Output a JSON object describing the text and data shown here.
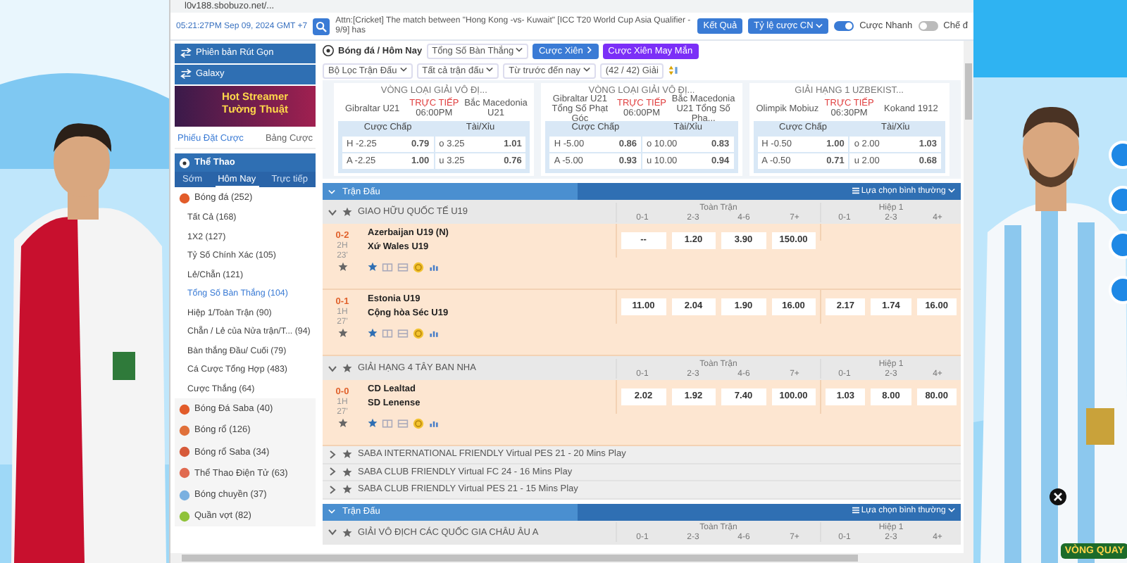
{
  "address_bar": {
    "url": "l0v188.sbobuzo.net/..."
  },
  "header": {
    "clock": "05:21:27PM Sep 09, 2024 GMT +7",
    "announcement": "Attn:[Cricket] The match between \"Hong Kong -vs- Kuwait\" [ICC T20 World Cup Asia Qualifier - 9/9] has",
    "results_button": "Kết Quả",
    "odds_dropdown": "Tỷ lệ cược CN",
    "toggles": [
      {
        "label": "Cược Nhanh",
        "on": true
      },
      {
        "label": "Chế đ",
        "on": false
      }
    ]
  },
  "sidebar": {
    "banners": [
      {
        "label": "Phiên bản Rút Gọn",
        "kind": "bar"
      },
      {
        "label": "Galaxy",
        "kind": "bar"
      },
      {
        "label": "Hot Streamer Tường Thuật",
        "kind": "promo"
      }
    ],
    "slip_tabs": [
      {
        "label": "Phiếu Đặt Cược",
        "selected": true
      },
      {
        "label": "Bảng Cược",
        "selected": false
      }
    ],
    "sports_title": "Thể Thao",
    "period_tabs": [
      {
        "label": "Sớm",
        "selected": false
      },
      {
        "label": "Hôm Nay",
        "selected": true
      },
      {
        "label": "Trực tiếp",
        "selected": false
      }
    ],
    "sports": [
      {
        "label": "Bóng đá (252)",
        "children": [
          {
            "label": "Tất Cả (168)",
            "selected": false
          },
          {
            "label": "1X2 (127)",
            "selected": false
          },
          {
            "label": "Tỷ Số Chính Xác (105)",
            "selected": false
          },
          {
            "label": "Lẻ/Chẵn (121)",
            "selected": false
          },
          {
            "label": "Tổng Số Bàn Thắng (104)",
            "selected": true
          },
          {
            "label": "Hiệp 1/Toàn Trận (90)",
            "selected": false
          },
          {
            "label": "Chẵn / Lẻ của Nửa trận/T... (94)",
            "selected": false
          },
          {
            "label": "Bàn thắng Đầu/ Cuối (79)",
            "selected": false
          },
          {
            "label": "Cá Cược Tổng Hợp (483)",
            "selected": false
          },
          {
            "label": "Cược Thắng (64)",
            "selected": false
          }
        ]
      },
      {
        "label": "Bóng Đá Saba (40)"
      },
      {
        "label": "Bóng rổ (126)"
      },
      {
        "label": "Bóng rổ Saba (34)"
      },
      {
        "label": "Thể Thao Điện Tử (63)"
      },
      {
        "label": "Bóng chuyền (37)"
      },
      {
        "label": "Quần vợt (82)"
      }
    ]
  },
  "main": {
    "breadcrumb": "Bóng đá / Hôm Nay",
    "market_dropdown": "Tổng Số Bàn Thắng",
    "parlay_button": "Cược Xiên",
    "lucky_parlay_button": "Cược Xiên May Mắn",
    "filters": [
      "Bộ Lọc Trận Đấu",
      "Tất cả trận đấu",
      "Từ trước đến nay"
    ],
    "league_count": "(42 / 42) Giải",
    "featured": [
      {
        "league": "VÒNG LOẠI GIẢI VÔ ĐỊ...",
        "home": "Gibraltar U21",
        "status": "TRỰC TIẾP",
        "time": "06:00PM",
        "away": "Bắc Macedonia U21",
        "handicap_label": "Cược Chấp",
        "total_label": "Tài/Xỉu",
        "rows": [
          [
            "H",
            "-2.25",
            "0.79",
            "o 3.25",
            "1.01"
          ],
          [
            "A",
            "-2.25",
            "1.00",
            "u 3.25",
            "0.76"
          ]
        ]
      },
      {
        "league": "VÒNG LOẠI GIẢI VÔ ĐỊ...",
        "home": "Gibraltar U21 Tổng Số Phạt Góc",
        "status": "TRỰC TIẾP",
        "time": "06:00PM",
        "away": "Bắc Macedonia U21 Tổng Số Phạ...",
        "handicap_label": "Cược Chấp",
        "total_label": "Tài/Xỉu",
        "rows": [
          [
            "H",
            "-5.00",
            "0.86",
            "o 10.00",
            "0.83"
          ],
          [
            "A",
            "-5.00",
            "0.93",
            "u 10.00",
            "0.94"
          ]
        ]
      },
      {
        "league": "GIẢI HẠNG 1 UZBEKIST...",
        "home": "Olimpik Mobiuz",
        "status": "TRỰC TIẾP",
        "time": "06:30PM",
        "away": "Kokand 1912",
        "handicap_label": "Cược Chấp",
        "total_label": "Tài/Xỉu",
        "rows": [
          [
            "H",
            "-0.50",
            "1.00",
            "o 2.00",
            "1.03"
          ],
          [
            "A",
            "-0.50",
            "0.71",
            "u 2.00",
            "0.68"
          ]
        ]
      }
    ],
    "sections": [
      {
        "title": "Trận Đấu",
        "view_option": "Lựa chọn bình thường",
        "leagues": [
          {
            "name": "GIAO HỮU QUỐC TẾ U19",
            "expanded": true,
            "groups": [
              {
                "title": "Toàn Trận",
                "columns": [
                  "0-1",
                  "2-3",
                  "4-6",
                  "7+"
                ]
              },
              {
                "title": "Hiệp 1",
                "columns": [
                  "0-1",
                  "2-3",
                  "4+"
                ]
              }
            ],
            "matches": [
              {
                "score": "0-2",
                "period": "2H",
                "minute": "23'",
                "home": "Azerbaijan U19 (N)",
                "away": "Xứ Wales U19",
                "full_time": [
                  "--",
                  "1.20",
                  "3.90",
                  "150.00"
                ]
              },
              {
                "score": "0-1",
                "period": "1H",
                "minute": "27'",
                "home": "Estonia U19",
                "away": "Cộng hòa Séc U19",
                "full_time": [
                  "11.00",
                  "2.04",
                  "1.90",
                  "16.00"
                ],
                "first_half": [
                  "2.17",
                  "1.74",
                  "16.00"
                ]
              }
            ]
          },
          {
            "name": "GIẢI HẠNG 4 TÂY BAN NHA",
            "expanded": true,
            "groups": [
              {
                "title": "Toàn Trận",
                "columns": [
                  "0-1",
                  "2-3",
                  "4-6",
                  "7+"
                ]
              },
              {
                "title": "Hiệp 1",
                "columns": [
                  "0-1",
                  "2-3",
                  "4+"
                ]
              }
            ],
            "matches": [
              {
                "score": "0-0",
                "period": "1H",
                "minute": "27'",
                "home": "CD Lealtad",
                "away": "SD Lenense",
                "full_time": [
                  "2.02",
                  "1.92",
                  "7.40",
                  "100.00"
                ],
                "first_half": [
                  "1.03",
                  "8.00",
                  "80.00"
                ]
              }
            ]
          },
          {
            "name": "SABA INTERNATIONAL FRIENDLY Virtual PES 21 - 20 Mins Play",
            "expanded": false
          },
          {
            "name": "SABA CLUB FRIENDLY Virtual FC 24 - 16 Mins Play",
            "expanded": false
          },
          {
            "name": "SABA CLUB FRIENDLY Virtual PES 21 - 15 Mins Play",
            "expanded": false
          }
        ]
      },
      {
        "title": "Trận Đấu",
        "view_option": "Lựa chọn bình thường",
        "leagues": [
          {
            "name": "GIẢI VÔ ĐỊCH CÁC QUỐC GIA CHÂU ÂU A",
            "expanded": true,
            "groups": [
              {
                "title": "Toàn Trận",
                "columns": [
                  "0-1",
                  "2-3",
                  "4-6",
                  "7+"
                ]
              },
              {
                "title": "Hiệp 1",
                "columns": [
                  "0-1",
                  "2-3",
                  "4+"
                ]
              }
            ]
          }
        ]
      }
    ]
  },
  "overlay": {
    "badge": "VÒNG QUAY"
  }
}
